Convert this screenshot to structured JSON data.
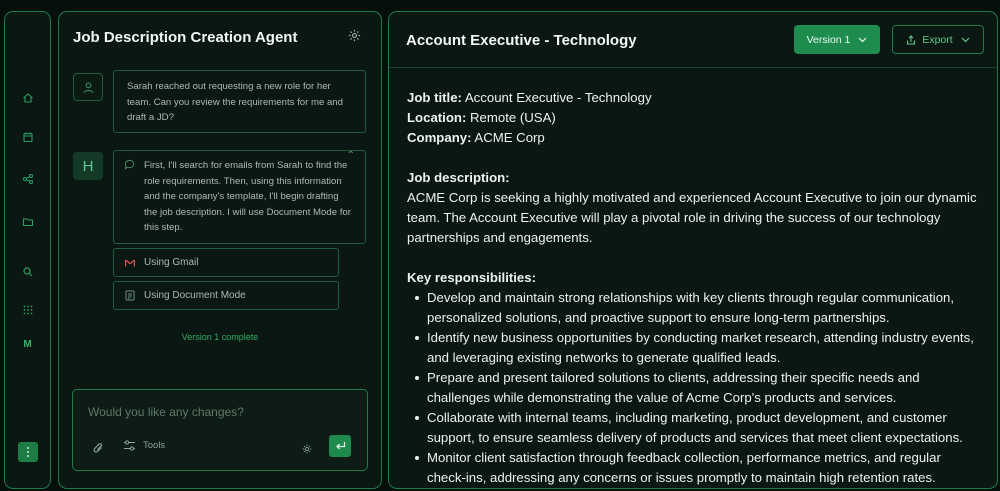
{
  "rail": {
    "icons": [
      "home-icon",
      "calendar-icon",
      "share-icon",
      "folder-icon",
      "search-icon",
      "grid-icon"
    ],
    "m_label": "M"
  },
  "agent": {
    "title": "Job Description Creation Agent",
    "user_avatar_icon": "user-icon",
    "user_message": "Sarah reached out requesting a new role for her team. Can you review the requirements for me and draft a JD?",
    "bot_avatar_letter": "H",
    "bot_message": "First, I'll search for emails from Sarah to find the role requirements. Then, using this information and the company's template, I'll begin drafting the job description. I will use Document Mode for this step.",
    "tools": [
      {
        "icon": "gmail-icon",
        "label": "Using Gmail"
      },
      {
        "icon": "document-icon",
        "label": "Using Document Mode"
      }
    ],
    "version_complete": "Version 1 complete",
    "input_placeholder": "Would you like any changes?",
    "tools_label": "Tools"
  },
  "doc": {
    "title": "Account Executive - Technology",
    "version_label": "Version 1",
    "export_label": "Export",
    "fields": [
      {
        "label": "Job title:",
        "value": "Account Executive - Technology"
      },
      {
        "label": "Location:",
        "value": "Remote (USA)"
      },
      {
        "label": "Company:",
        "value": "ACME Corp"
      }
    ],
    "description_heading": "Job description:",
    "description": "ACME Corp is seeking a highly motivated and experienced Account Executive to join our dynamic team. The Account Executive will play a pivotal role in driving the success of our technology partnerships and engagements.",
    "responsibilities_heading": "Key responsibilities:",
    "responsibilities": [
      "Develop and maintain strong relationships with key clients through regular communication, personalized solutions, and proactive support to ensure long-term partnerships.",
      "Identify new business opportunities by conducting market research, attending industry events, and leveraging existing networks to generate qualified leads.",
      "Prepare and present tailored solutions to clients, addressing their specific needs and challenges while demonstrating the value of Acme Corp's products and services.",
      "Collaborate with internal teams, including marketing, product development, and customer support, to ensure seamless delivery of products and services that meet client expectations.",
      "Monitor client satisfaction through feedback collection, performance metrics, and regular check-ins, addressing any concerns or issues promptly to maintain high retention rates."
    ]
  },
  "colors": {
    "accent": "#1f8c4f",
    "border": "#1f7a4a",
    "background": "#060f0b"
  }
}
